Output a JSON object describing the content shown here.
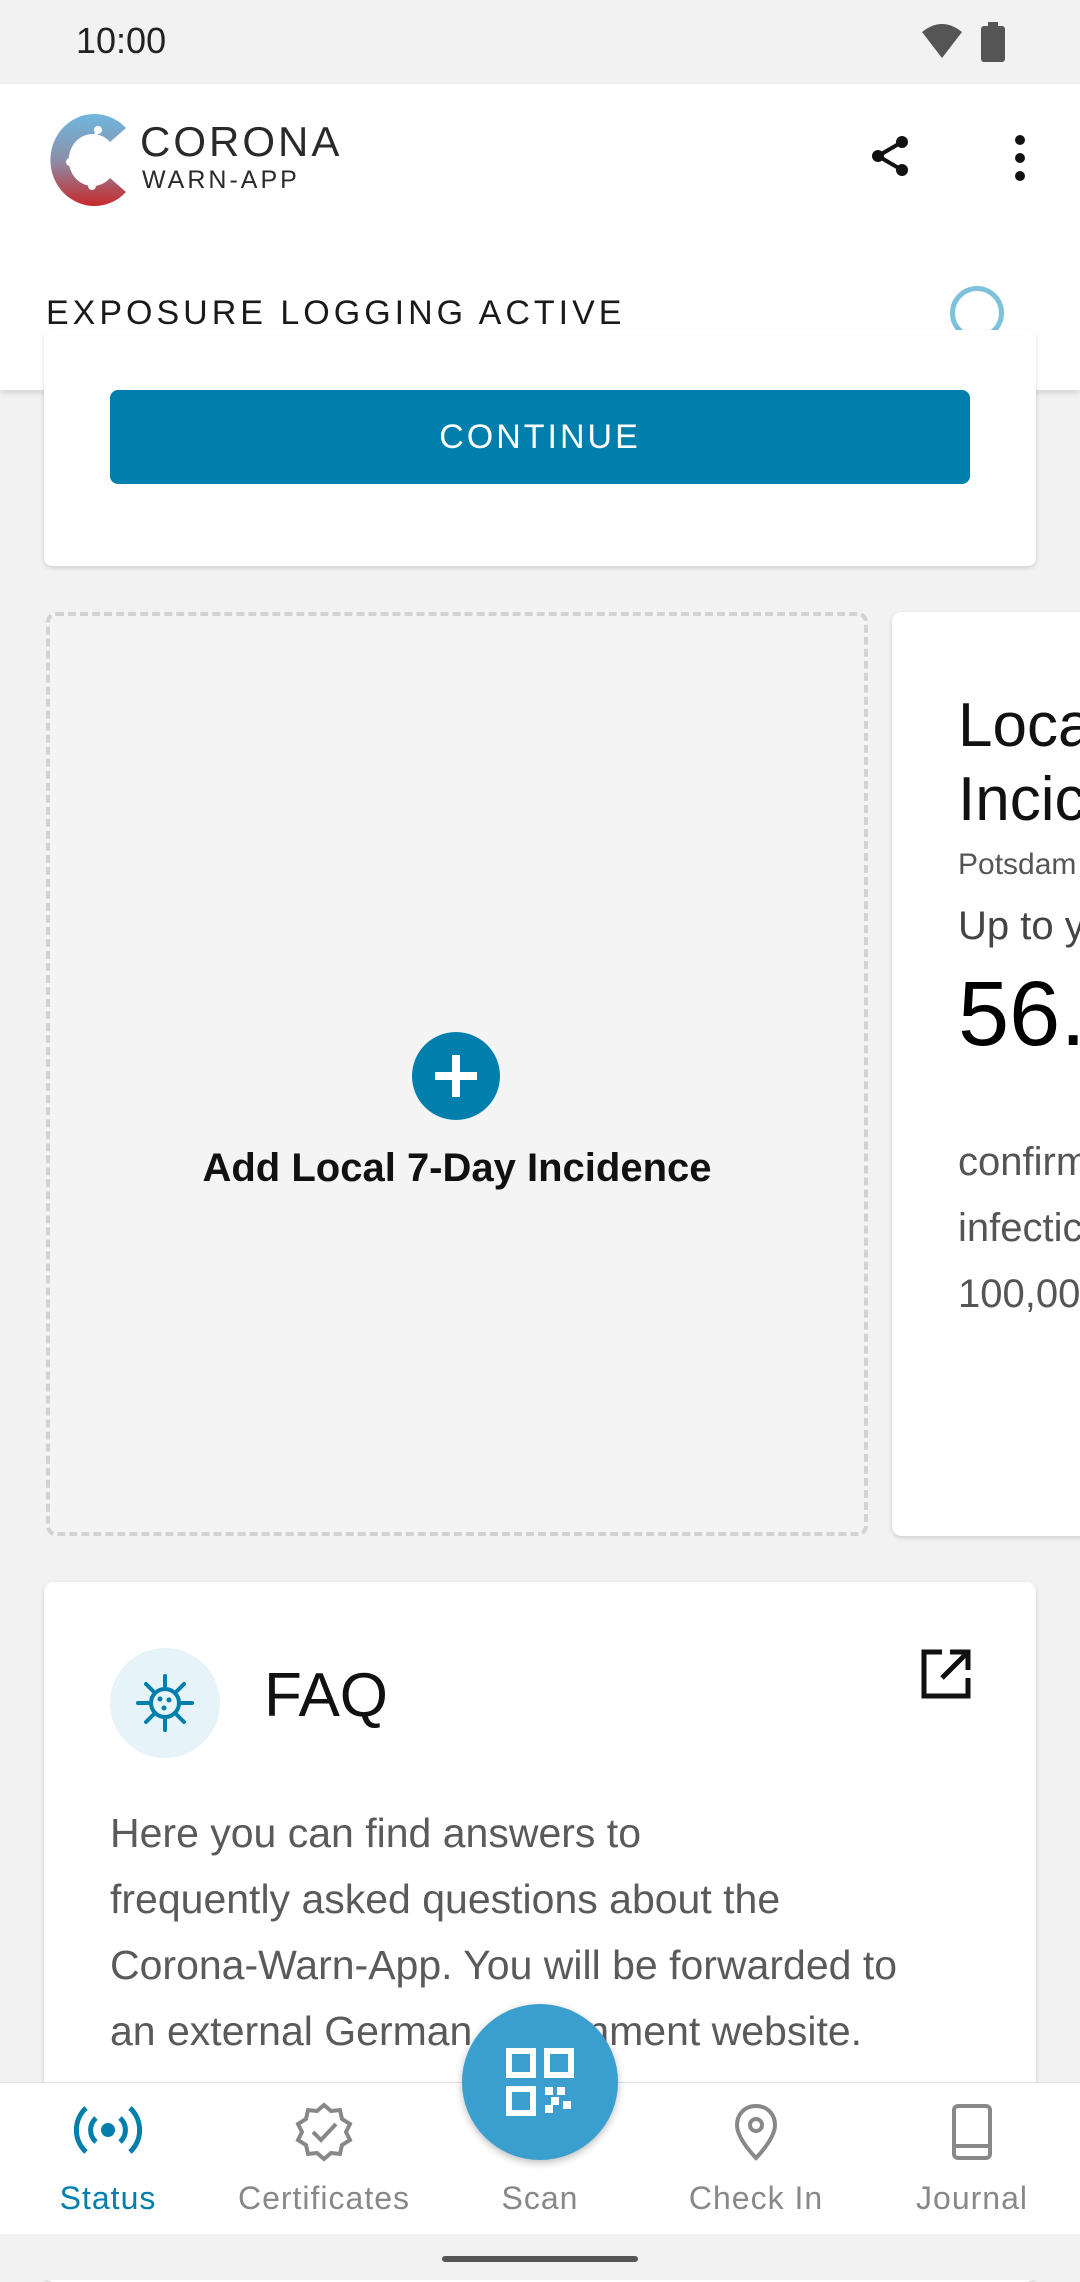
{
  "status_bar": {
    "time": "10:00"
  },
  "header": {
    "app_name_line1": "CORONA",
    "app_name_line2": "WARN-APP",
    "exposure_label": "EXPOSURE LOGGING ACTIVE"
  },
  "risk_card": {
    "continue_label": "CONTINUE"
  },
  "add_incidence": {
    "label": "Add Local 7-Day Incidence"
  },
  "local_incidence": {
    "title_line1": "Loca",
    "title_line2": "Incic",
    "region": "Potsdam",
    "date_prefix": "Up to y",
    "value": "56.",
    "desc_line1": "confirm",
    "desc_line2": "infectic",
    "desc_line3": "100,00"
  },
  "faq": {
    "title": "FAQ",
    "body_line1": "Here you can find answers to",
    "body_line2": "frequently asked questions about the",
    "body_line3": "Corona-Warn-App. You will be forwarded to",
    "body_line4": "an external German government website."
  },
  "bottom_nav": {
    "items": [
      {
        "label": "Status",
        "icon": "status-broadcast-icon",
        "active": true
      },
      {
        "label": "Certificates",
        "icon": "certificate-badge-icon",
        "active": false
      },
      {
        "label": "Scan",
        "icon": "qr-code-icon",
        "active": false
      },
      {
        "label": "Check In",
        "icon": "location-pin-icon",
        "active": false
      },
      {
        "label": "Journal",
        "icon": "book-icon",
        "active": false
      }
    ]
  },
  "colors": {
    "accent": "#007fad",
    "fab": "#3a9fce",
    "indicator": "#7ec1dd"
  }
}
